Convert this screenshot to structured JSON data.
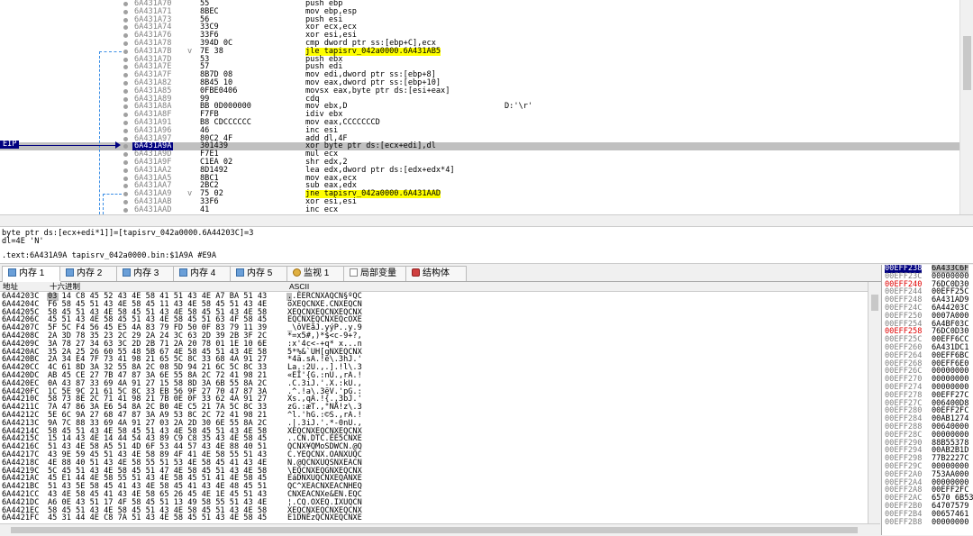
{
  "eip_label": "EIP",
  "disasm": [
    {
      "addr": "6A431A70",
      "bytes": "55",
      "instr": "push ebp",
      "comment": ""
    },
    {
      "addr": "6A431A71",
      "bytes": "8BEC",
      "instr": "mov ebp,esp",
      "comment": ""
    },
    {
      "addr": "6A431A73",
      "bytes": "56",
      "instr": "push esi",
      "comment": ""
    },
    {
      "addr": "6A431A74",
      "bytes": "33C9",
      "instr": "xor ecx,ecx",
      "comment": ""
    },
    {
      "addr": "6A431A76",
      "bytes": "33F6",
      "instr": "xor esi,esi",
      "comment": ""
    },
    {
      "addr": "6A431A78",
      "bytes": "394D 0C",
      "instr": "cmp dword ptr ss:[ebp+C],ecx",
      "comment": ""
    },
    {
      "addr": "6A431A7B",
      "bytes": "7E 38",
      "instr": "jle tapisrv_042a0000.6A431AB5",
      "comment": "",
      "jump": true,
      "arrow": "v"
    },
    {
      "addr": "6A431A7D",
      "bytes": "53",
      "instr": "push ebx",
      "comment": ""
    },
    {
      "addr": "6A431A7E",
      "bytes": "57",
      "instr": "push edi",
      "comment": ""
    },
    {
      "addr": "6A431A7F",
      "bytes": "8B7D 08",
      "instr": "mov edi,dword ptr ss:[ebp+8]",
      "comment": ""
    },
    {
      "addr": "6A431A82",
      "bytes": "8B45 10",
      "instr": "mov eax,dword ptr ss:[ebp+10]",
      "comment": ""
    },
    {
      "addr": "6A431A85",
      "bytes": "0FBE0406",
      "instr": "movsx eax,byte ptr ds:[esi+eax]",
      "comment": ""
    },
    {
      "addr": "6A431A89",
      "bytes": "99",
      "instr": "cdq",
      "comment": ""
    },
    {
      "addr": "6A431A8A",
      "bytes": "BB 0D000000",
      "instr": "mov ebx,D",
      "comment": "D:'\\r'"
    },
    {
      "addr": "6A431A8F",
      "bytes": "F7FB",
      "instr": "idiv ebx",
      "comment": ""
    },
    {
      "addr": "6A431A91",
      "bytes": "B8 CDCCCCCC",
      "instr": "mov eax,CCCCCCCD",
      "comment": ""
    },
    {
      "addr": "6A431A96",
      "bytes": "46",
      "instr": "inc esi",
      "comment": ""
    },
    {
      "addr": "6A431A97",
      "bytes": "80C2 4F",
      "instr": "add dl,4F",
      "comment": ""
    },
    {
      "addr": "6A431A9A",
      "bytes": "301439",
      "instr": "xor byte ptr ds:[ecx+edi],dl",
      "comment": "",
      "eip": true
    },
    {
      "addr": "6A431A9D",
      "bytes": "F7E1",
      "instr": "mul ecx",
      "comment": ""
    },
    {
      "addr": "6A431A9F",
      "bytes": "C1EA 02",
      "instr": "shr edx,2",
      "comment": ""
    },
    {
      "addr": "6A431AA2",
      "bytes": "8D1492",
      "instr": "lea edx,dword ptr ds:[edx+edx*4]",
      "comment": ""
    },
    {
      "addr": "6A431AA5",
      "bytes": "8BC1",
      "instr": "mov eax,ecx",
      "comment": ""
    },
    {
      "addr": "6A431AA7",
      "bytes": "2BC2",
      "instr": "sub eax,edx",
      "comment": ""
    },
    {
      "addr": "6A431AA9",
      "bytes": "75 02",
      "instr": "jne tapisrv_042a0000.6A431AAD",
      "comment": "",
      "jump": true,
      "arrow": "v"
    },
    {
      "addr": "6A431AAB",
      "bytes": "33F6",
      "instr": "xor esi,esi",
      "comment": ""
    },
    {
      "addr": "6A431AAD",
      "bytes": "41",
      "instr": "inc ecx",
      "comment": ""
    }
  ],
  "info": {
    "line1": "byte ptr ds:[ecx+edi*1]]=[tapisrv_042a0000.6A44203C]=3",
    "line2": "dl=4E 'N'",
    "line3": ".text:6A431A9A tapisrv_042a0000.bin:$1A9A #E9A"
  },
  "tabs": [
    {
      "label": "内存 1",
      "icon": "memory-icon",
      "active": true
    },
    {
      "label": "内存 2",
      "icon": "memory-icon"
    },
    {
      "label": "内存 3",
      "icon": "memory-icon"
    },
    {
      "label": "内存 4",
      "icon": "memory-icon"
    },
    {
      "label": "内存 5",
      "icon": "memory-icon"
    },
    {
      "label": "监视 1",
      "icon": "watch-icon"
    },
    {
      "label": "局部变量",
      "icon": "locals-icon"
    },
    {
      "label": "结构体",
      "icon": "struct-icon"
    }
  ],
  "dump": {
    "header_addr": "地址",
    "header_hex": "十六进制",
    "header_ascii": "ASCII",
    "rows": [
      {
        "addr": "6A44203C",
        "hex": "03 14 C8 45 52 43 4E 58 41 51 43 4E A7 BA 51 43",
        "ascii": "..ÈERCNXAQCN§ºQC"
      },
      {
        "addr": "6A44204C",
        "hex": "F6 58 45 51 43 4E 58 45 11 43 4E 58 45 51 43 4E",
        "ascii": "öXEQCNXE.CNXEQCN"
      },
      {
        "addr": "6A44205C",
        "hex": "58 45 51 43 4E 58 45 51 43 4E 58 45 51 43 4E 58",
        "ascii": "XEQCNXEQCNXEQCNX"
      },
      {
        "addr": "6A44206C",
        "hex": "45 51 43 4E 58 45 51 43 4E 58 45 51 63 4F 58 45",
        "ascii": "EQCNXEQCNXEQcOXE"
      },
      {
        "addr": "6A44207C",
        "hex": "5F 5C F4 56 45 E5 4A 83 79 FD 50 0F 83 79 11 39",
        "ascii": "_\\ôVEåJ.yýP..y.9"
      },
      {
        "addr": "6A44208C",
        "hex": "2A 3D 78 35 23 2C 29 2A 24 3C 63 2D 39 2B 3F 2C",
        "ascii": "*=x5#,)*$<c-9+?,"
      },
      {
        "addr": "6A44209C",
        "hex": "3A 78 27 34 63 3C 2D 2B 71 2A 20 78 01 1E 10 6E",
        "ascii": ":x'4c<-+q* x...n"
      },
      {
        "addr": "6A4420AC",
        "hex": "35 2A 25 26 60 55 48 5B 67 4E 58 45 51 43 4E 58",
        "ascii": "5*%&`UH[gNXEQCNX"
      },
      {
        "addr": "6A4420BC",
        "hex": "2A 34 E4 7F 73 41 98 21 65 5C 8C 33 68 4A 91 27",
        "ascii": "*4ä.sA.!e\\.3hJ.'"
      },
      {
        "addr": "6A4420CC",
        "hex": "4C 61 8D 3A 32 55 8A 2C 08 5D 94 21 6C 5C 8C 33",
        "ascii": "La.:2U.,.].!l\\.3"
      },
      {
        "addr": "6A4420DC",
        "hex": "AB 45 CE 27 7B 47 87 3A 6E 55 8A 2C 72 41 98 21",
        "ascii": "«EÎ'{G.:nU.,rA.!"
      },
      {
        "addr": "6A4420EC",
        "hex": "0A 43 87 33 69 4A 91 27 15 58 8D 3A 6B 55 8A 2C",
        "ascii": ".C.3iJ.'.X.:kU.,"
      },
      {
        "addr": "6A4420FC",
        "hex": "1C 5E 9C 21 61 5C 8C 33 EB 56 9F 27 70 47 87 3A",
        "ascii": ".^.!a\\.3ëV.'pG.:"
      },
      {
        "addr": "6A44210C",
        "hex": "58 73 8E 2C 71 41 98 21 7B 0E 0F 33 62 4A 91 27",
        "ascii": "Xs.,qA.!{..3bJ.'"
      },
      {
        "addr": "6A44211C",
        "hex": "7A 47 86 3A E6 54 8A 2C B0 4E C5 21 7A 5C 8C 33",
        "ascii": "zG.:æT.,°NÅ!z\\.3"
      },
      {
        "addr": "6A44212C",
        "hex": "5E 6C 9A 27 68 47 87 3A A9 53 8C 2C 72 41 98 21",
        "ascii": "^l.'hG.:©S.,rA.!"
      },
      {
        "addr": "6A44213C",
        "hex": "9A 7C 88 33 69 4A 91 27 03 2A 2D 30 6E 55 8A 2C",
        "ascii": ".|.3iJ.'.*-0nU.,"
      },
      {
        "addr": "6A44214C",
        "hex": "58 45 51 43 4E 58 45 51 43 4E 58 45 51 43 4E 58",
        "ascii": "XEQCNXEQCNXEQCNX"
      },
      {
        "addr": "6A44215C",
        "hex": "15 14 43 4E 14 44 54 43 89 C9 C8 35 43 4E 58 45",
        "ascii": "..CN.DTC.ÉÈ5CNXE"
      },
      {
        "addr": "6A44216C",
        "hex": "51 43 4E 58 A5 51 4D 6F 53 44 57 43 4E 88 40 51",
        "ascii": "QCNX¥QMoSDWCN.@Q"
      },
      {
        "addr": "6A44217C",
        "hex": "43 9E 59 45 51 43 4E 58 89 4F 41 4E 58 55 51 43",
        "ascii": "C.YEQCNX.OANXUQC"
      },
      {
        "addr": "6A44218C",
        "hex": "4E 88 40 51 43 4E 58 55 51 53 4E 58 45 41 43 4E",
        "ascii": "N.@QCNXUQSNXEACN"
      },
      {
        "addr": "6A44219C",
        "hex": "5C 45 51 43 4E 58 45 51 47 4E 58 45 51 43 4E 58",
        "ascii": "\\EQCNXEQGNXEQCNX"
      },
      {
        "addr": "6A4421AC",
        "hex": "45 E1 44 4E 58 55 51 43 4E 58 45 51 41 4E 58 45",
        "ascii": "EáDNXUQCNXEQANXE"
      },
      {
        "addr": "6A4421BC",
        "hex": "51 43 5E 58 45 41 43 4E 58 45 41 43 4E 48 45 51",
        "ascii": "QC^XEACNXEACNHEQ"
      },
      {
        "addr": "6A4421CC",
        "hex": "43 4E 58 45 41 43 4E 58 65 26 45 4E 1E 45 51 43",
        "ascii": "CNXEACNXe&EN.EQC"
      },
      {
        "addr": "6A4421DC",
        "hex": "A6 0E 43 51 17 4F 58 45 51 13 49 58 55 51 43 4E",
        "ascii": "¦.CQ.OXEQ.IXUQCN"
      },
      {
        "addr": "6A4421EC",
        "hex": "58 45 51 43 4E 58 45 51 43 4E 58 45 51 43 4E 58",
        "ascii": "XEQCNXEQCNXEQCNX"
      },
      {
        "addr": "6A4421FC",
        "hex": "45 31 44 4E C8 7A 51 43 4E 58 45 51 43 4E 58 45",
        "ascii": "E1DNÈzQCNXEQCNXE"
      }
    ]
  },
  "stack": [
    {
      "addr": "00EFF238",
      "val": "6A433C6F",
      "top": true
    },
    {
      "addr": "00EFF23C",
      "val": "00000000"
    },
    {
      "addr": "00EFF240",
      "val": "76DC0D30",
      "red": true
    },
    {
      "addr": "00EFF244",
      "val": "00EFF25C"
    },
    {
      "addr": "00EFF248",
      "val": "6A431AD9"
    },
    {
      "addr": "00EFF24C",
      "val": "6A44203C"
    },
    {
      "addr": "00EFF250",
      "val": "0007A000"
    },
    {
      "addr": "00EFF254",
      "val": "6A4BF03C"
    },
    {
      "addr": "00EFF258",
      "val": "76DC0D30",
      "red": true
    },
    {
      "addr": "00EFF25C",
      "val": "00EFF6CC"
    },
    {
      "addr": "00EFF260",
      "val": "6A431DC1"
    },
    {
      "addr": "00EFF264",
      "val": "00EFF6BC"
    },
    {
      "addr": "00EFF268",
      "val": "00EFF6E0"
    },
    {
      "addr": "00EFF26C",
      "val": "00000000"
    },
    {
      "addr": "00EFF270",
      "val": "00000000"
    },
    {
      "addr": "00EFF274",
      "val": "00000000"
    },
    {
      "addr": "00EFF278",
      "val": "00EFF27C"
    },
    {
      "addr": "00EFF27C",
      "val": "006400D8"
    },
    {
      "addr": "00EFF280",
      "val": "00EFF2FC"
    },
    {
      "addr": "00EFF284",
      "val": "00AB1274"
    },
    {
      "addr": "00EFF288",
      "val": "00640000"
    },
    {
      "addr": "00EFF28C",
      "val": "00000000"
    },
    {
      "addr": "00EFF290",
      "val": "88B55378"
    },
    {
      "addr": "00EFF294",
      "val": "00AB2B1D"
    },
    {
      "addr": "00EFF298",
      "val": "77B2227C"
    },
    {
      "addr": "00EFF29C",
      "val": "00000000"
    },
    {
      "addr": "00EFF2A0",
      "val": "753AA000"
    },
    {
      "addr": "00EFF2A4",
      "val": "00000000"
    },
    {
      "addr": "00EFF2A8",
      "val": "00EFF2FC"
    },
    {
      "addr": "00EFF2AC",
      "val": "6570 6B53"
    },
    {
      "addr": "00EFF2B0",
      "val": "64707579"
    },
    {
      "addr": "00EFF2B4",
      "val": "00657461"
    },
    {
      "addr": "00EFF2B8",
      "val": "00000000"
    }
  ]
}
